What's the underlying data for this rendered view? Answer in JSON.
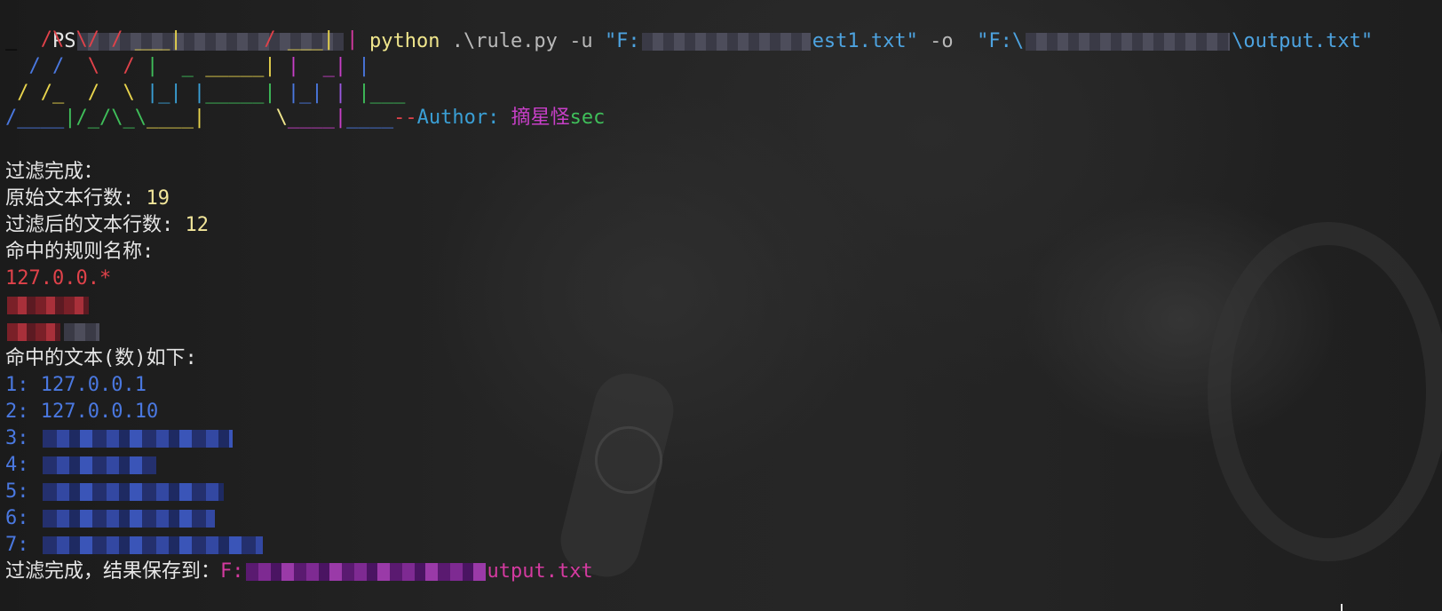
{
  "terminal": {
    "prompt": "PS",
    "command": {
      "program": "python",
      "script": ".\\rule.py",
      "flag_u": "-u",
      "input_prefix": "\"F:",
      "input_suffix": "est1.txt\"",
      "flag_o": "-o",
      "output_prefix": "\"F:\\",
      "output_suffix": "\\output.txt\""
    },
    "banner": {
      "row1": [
        "_  ",
        "/\\ \\/ / ",
        "___|",
        "       / ",
        "___| ",
        "|"
      ],
      "row2": [
        "  / /  ",
        "\\  /",
        " |  _ ",
        "_____| ",
        "|  _| ",
        "|"
      ],
      "row3": [
        " / /_  /  \\ ",
        "|_| |",
        "_____| ",
        "|_| ",
        "| ",
        "|___"
      ],
      "row4": [
        "/____",
        "|/_/\\_\\",
        "____|",
        "      \\",
        "____|",
        "____",
        "--",
        "Author: ",
        "摘星怪",
        "sec"
      ]
    },
    "output": {
      "status": "过滤完成：",
      "original_lines_label": "原始文本行数: ",
      "original_lines_value": "19",
      "filtered_lines_label": "过滤后的文本行数: ",
      "filtered_lines_value": "12",
      "rules_label": "命中的规则名称:",
      "rule_1": "127.0.0.*",
      "hits_label": "命中的文本(数)如下:",
      "hits": [
        {
          "index": "1:",
          "value": "127.0.0.1"
        },
        {
          "index": "2:",
          "value": "127.0.0.10"
        },
        {
          "index": "3:",
          "value": ""
        },
        {
          "index": "4:",
          "value": ""
        },
        {
          "index": "5:",
          "value": ""
        },
        {
          "index": "6:",
          "value": ""
        },
        {
          "index": "7:",
          "value": ""
        }
      ],
      "saved_label": "过滤完成，结果保存到：",
      "saved_prefix": "F:",
      "saved_suffix": "utput.txt"
    }
  },
  "colors": {
    "command": "#f0e68c",
    "path": "#4da3e0",
    "rule": "#e0424a",
    "hits": "#4a78e0",
    "saved_path": "#d43aa0"
  }
}
